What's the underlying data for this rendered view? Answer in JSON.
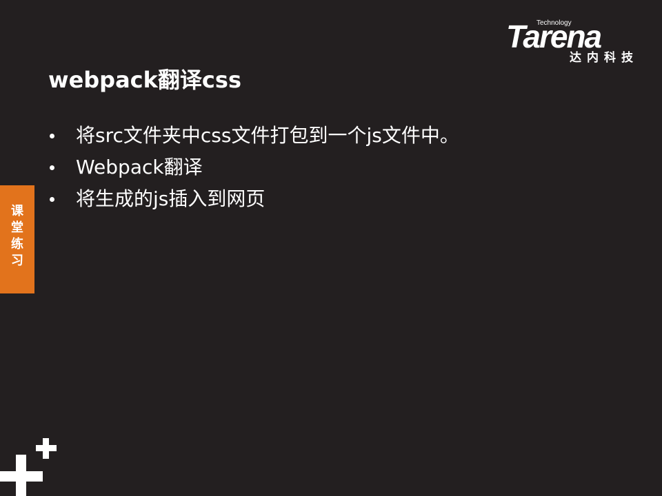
{
  "colors": {
    "background": "#231f20",
    "text": "#ffffff",
    "accent": "#e2731c"
  },
  "logo": {
    "tagline": "Technology",
    "wordmark": "Tarena",
    "chinese": "达内科技"
  },
  "slide": {
    "title": "webpack翻译css",
    "bullets": [
      {
        "text": "将src文件夹中css文件打包到一个js文件中。"
      },
      {
        "text": "Webpack翻译"
      },
      {
        "text": "将生成的js插入到网页"
      }
    ]
  },
  "side_tab": {
    "label": "课堂练习"
  },
  "decoration": {
    "corner_icon": "plus-plus-icon"
  }
}
